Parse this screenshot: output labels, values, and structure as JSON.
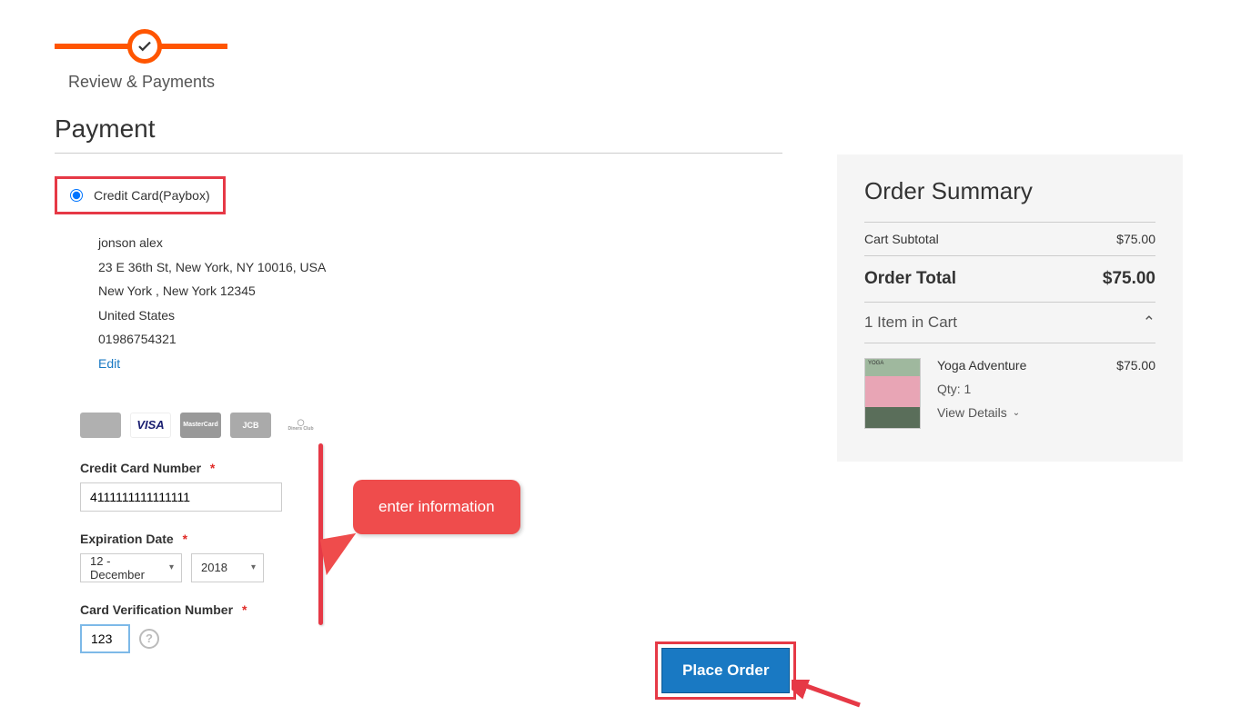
{
  "progress": {
    "step_label": "Review & Payments"
  },
  "payment": {
    "section_title": "Payment",
    "method_label": "Credit Card(Paybox)",
    "billing": {
      "name": "jonson alex",
      "street": "23 E 36th St, New York, NY 10016, USA",
      "city_region": "New York , New York 12345",
      "country": "United States",
      "phone": "01986754321",
      "edit_label": "Edit"
    },
    "cc": {
      "number_label": "Credit Card Number",
      "number_value": "4111111111111111",
      "exp_label": "Expiration Date",
      "month_value": "12 - December",
      "year_value": "2018",
      "cvv_label": "Card Verification Number",
      "cvv_value": "123"
    }
  },
  "annotations": {
    "callout_text": "enter information"
  },
  "actions": {
    "place_order_label": "Place Order"
  },
  "summary": {
    "title": "Order Summary",
    "subtotal_label": "Cart Subtotal",
    "subtotal_value": "$75.00",
    "total_label": "Order Total",
    "total_value": "$75.00",
    "cart_header": "1 Item in Cart",
    "item": {
      "name": "Yoga Adventure",
      "price": "$75.00",
      "qty_label": "Qty: 1",
      "view_details": "View Details"
    }
  },
  "card_brands": {
    "visa": "VISA",
    "mastercard": "MasterCard",
    "jcb": "JCB",
    "diners_top": "◯",
    "diners_bottom": "Diners Club"
  }
}
